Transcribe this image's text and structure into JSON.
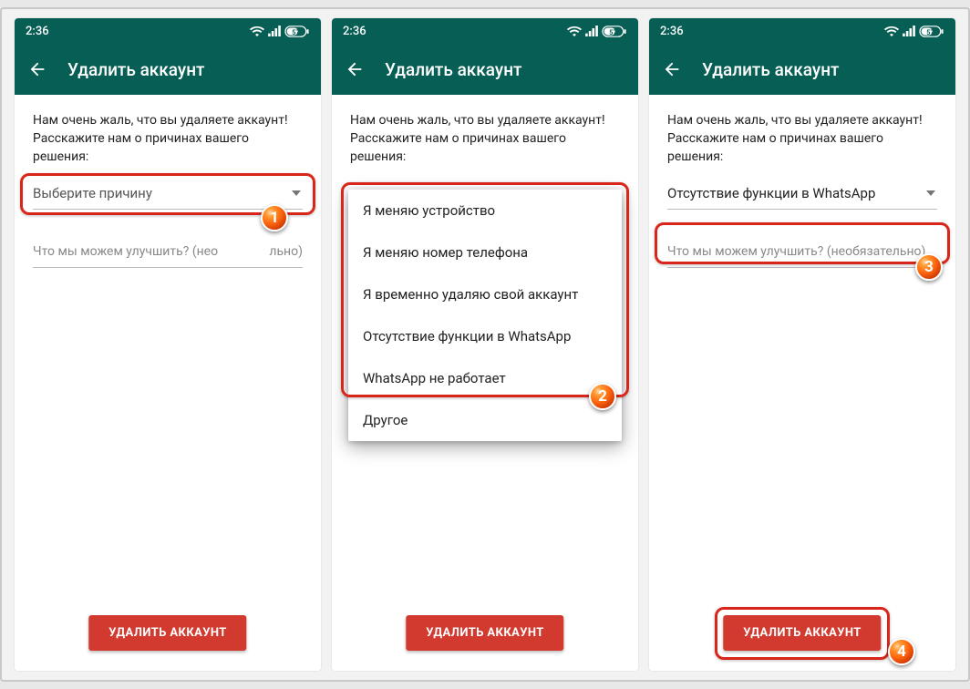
{
  "status": {
    "time": "2:36",
    "battery": "57"
  },
  "appbar": {
    "title": "Удалить аккаунт"
  },
  "intro": "Нам очень жаль, что вы удаляете аккаунт! Расскажите нам о причинах вашего решения:",
  "select": {
    "placeholder": "Выберите причину",
    "selected": "Отсутствие функции в WhatsApp"
  },
  "dropdown": [
    "Я меняю устройство",
    "Я меняю номер телефона",
    "Я временно удаляю свой аккаунт",
    "Отсутствие функции в WhatsApp",
    "WhatsApp не работает",
    "Другое"
  ],
  "improve": {
    "placeholder": "Что мы можем улучшить? (необязательно)",
    "placeholder_left": "Что мы можем улучшить? (нео",
    "placeholder_right": "льно)"
  },
  "delete_label": "УДАЛИТЬ АККАУНТ",
  "badges": {
    "b1": "1",
    "b2": "2",
    "b3": "3",
    "b4": "4"
  }
}
